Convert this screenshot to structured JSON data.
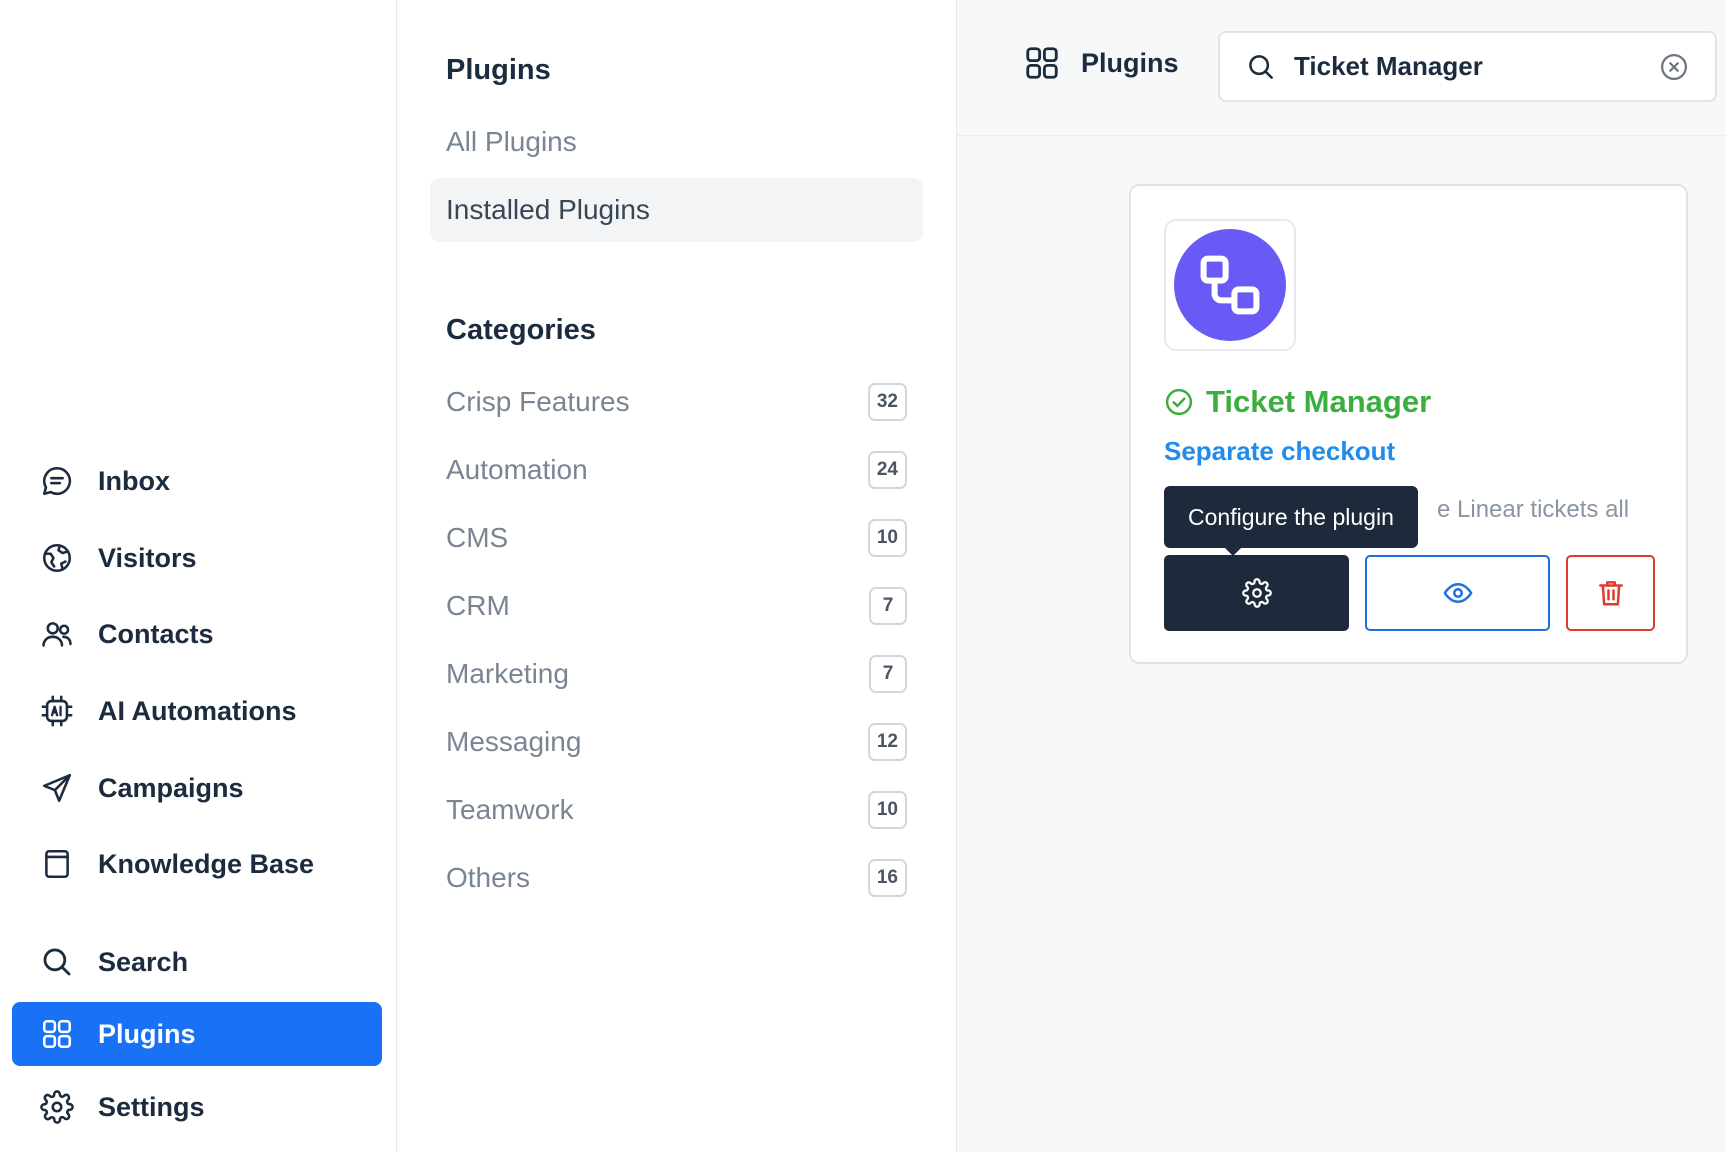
{
  "nav": {
    "items": [
      {
        "label": "Inbox",
        "icon": "chat-bubble-icon"
      },
      {
        "label": "Visitors",
        "icon": "globe-icon"
      },
      {
        "label": "Contacts",
        "icon": "users-icon"
      },
      {
        "label": "AI Automations",
        "icon": "ai-chip-icon"
      },
      {
        "label": "Campaigns",
        "icon": "paper-plane-icon"
      },
      {
        "label": "Knowledge Base",
        "icon": "book-icon"
      },
      {
        "label": "Search",
        "icon": "search-icon"
      },
      {
        "label": "Plugins",
        "icon": "grid-icon",
        "active": true
      },
      {
        "label": "Settings",
        "icon": "gear-icon"
      }
    ],
    "active_color": "#1972f5"
  },
  "sidebar": {
    "plugins_heading": "Plugins",
    "links": [
      {
        "label": "All Plugins"
      },
      {
        "label": "Installed Plugins",
        "selected": true
      }
    ],
    "categories_heading": "Categories",
    "categories": [
      {
        "label": "Crisp Features",
        "count": "32"
      },
      {
        "label": "Automation",
        "count": "24"
      },
      {
        "label": "CMS",
        "count": "10"
      },
      {
        "label": "CRM",
        "count": "7"
      },
      {
        "label": "Marketing",
        "count": "7"
      },
      {
        "label": "Messaging",
        "count": "12"
      },
      {
        "label": "Teamwork",
        "count": "10"
      },
      {
        "label": "Others",
        "count": "16"
      }
    ]
  },
  "header": {
    "title": "Plugins",
    "search": {
      "value": "Ticket Manager",
      "placeholder": "Search"
    }
  },
  "plugin_card": {
    "name": "Ticket Manager",
    "status": "installed",
    "subtitle": "Separate checkout",
    "description_visible": "e Linear tickets all",
    "tooltip": "Configure the plugin",
    "colors": {
      "name": "#3cae3f",
      "subtitle": "#1f8ceb",
      "logo": "#6a5af5",
      "delete": "#e03a2c",
      "preview": "#1f6fe0",
      "config": "#1d2a3b"
    }
  }
}
